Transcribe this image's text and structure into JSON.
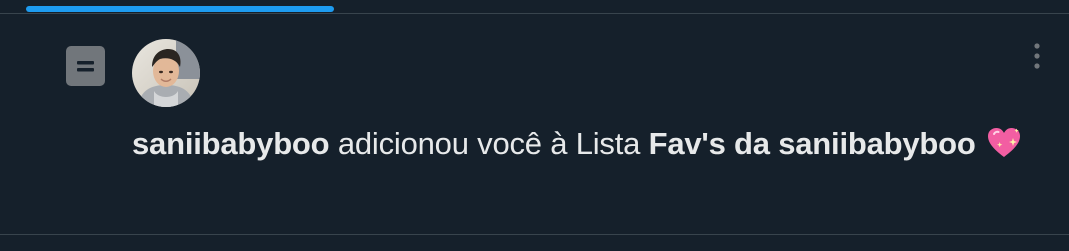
{
  "notification": {
    "actor_username": "saniibabyboo",
    "action_text": " adicionou você à Lista ",
    "list_name": "Fav's da saniibabyboo",
    "emoji": "sparkling-heart-icon",
    "more_label": "More"
  },
  "colors": {
    "background": "#15202b",
    "accent": "#1d9bf0",
    "divider": "#38444d",
    "text": "#e7e9ea",
    "icon_gray": "#71767b",
    "heart_pink": "#f25ea2"
  }
}
